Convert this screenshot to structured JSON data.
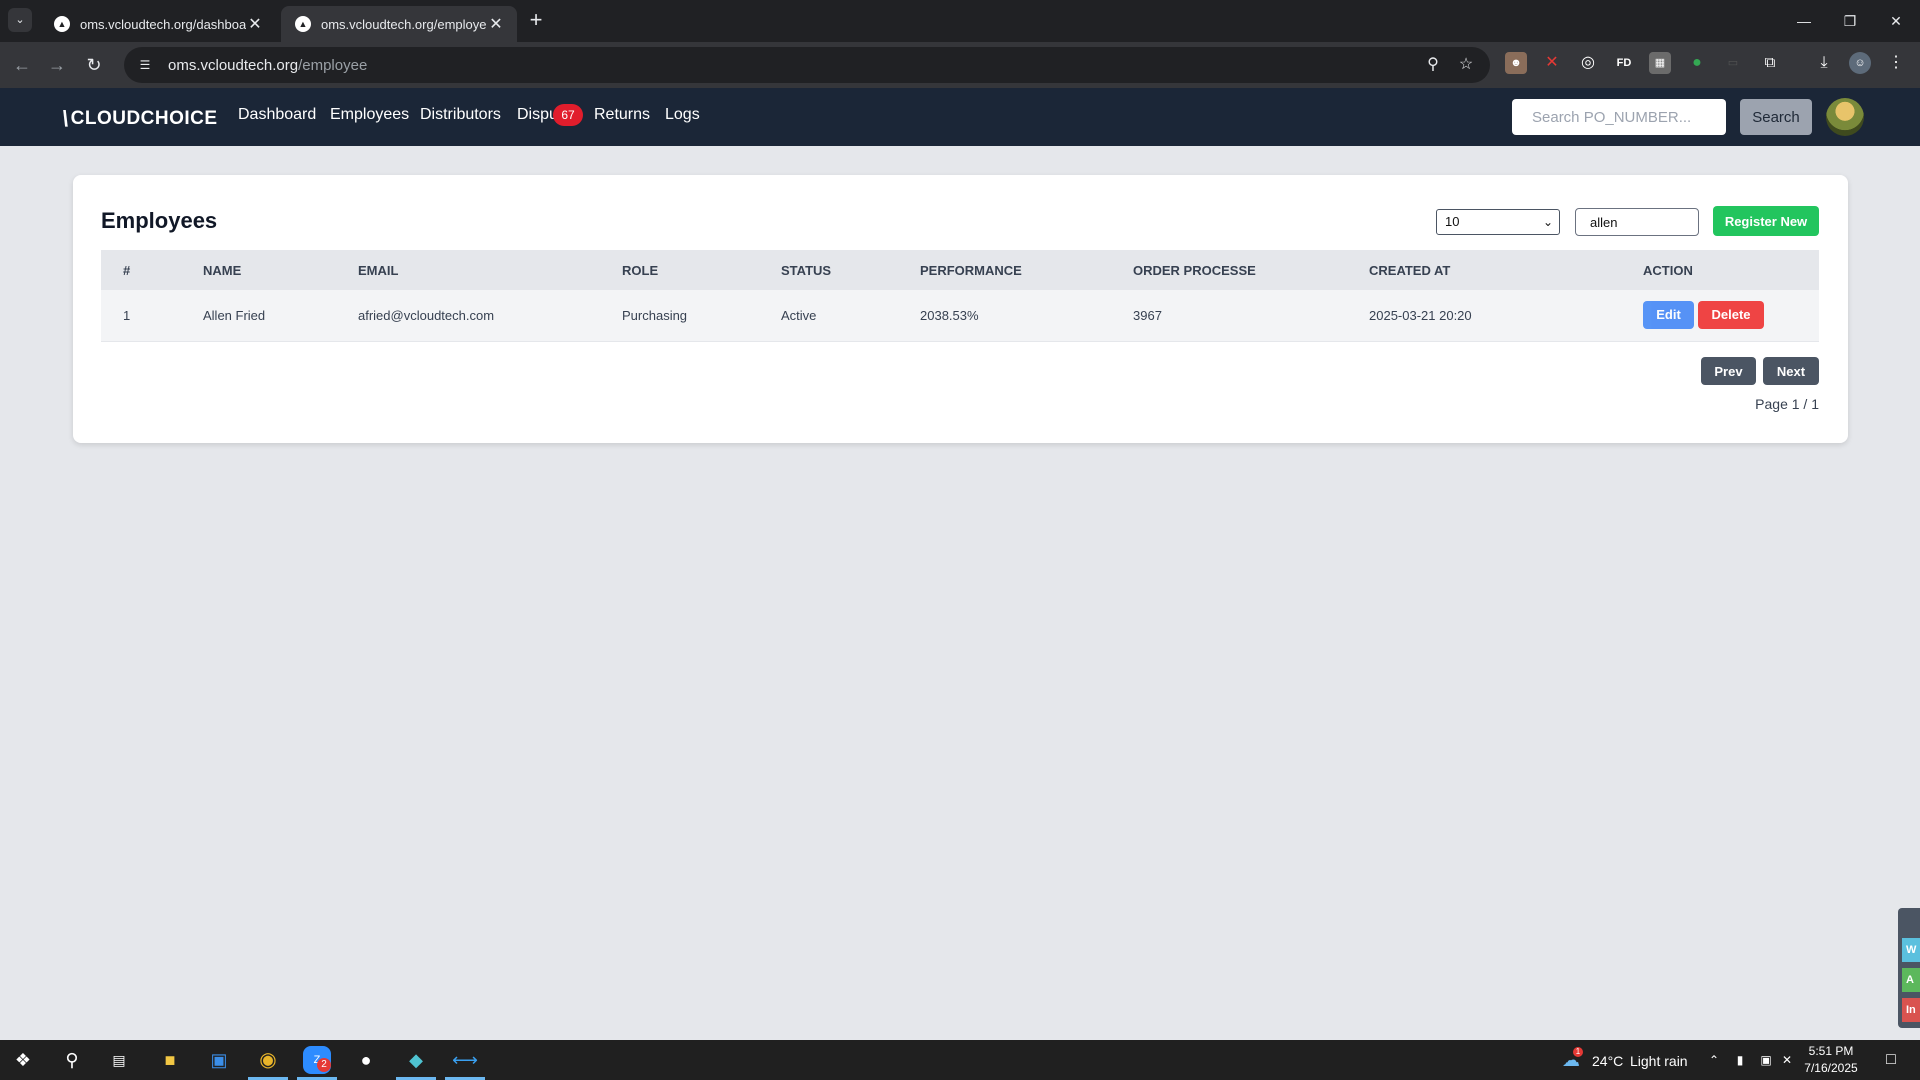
{
  "browser": {
    "tabs": [
      {
        "title": "oms.vcloudtech.org/dashboard",
        "active": false
      },
      {
        "title": "oms.vcloudtech.org/employee",
        "active": true
      }
    ],
    "url_host": "oms.vcloudtech.org",
    "url_path": "/employee",
    "extensions": [
      "puzzle-face-icon",
      "x-icon",
      "globe-icon",
      "fd-icon",
      "image-icon",
      "green-circle-icon",
      "cast-icon",
      "puzzle-icon",
      "download-icon",
      "profile-icon",
      "menu-icon"
    ]
  },
  "nav": {
    "logo_text": "CLOUDCHOICE",
    "links": [
      {
        "label": "Dashboard"
      },
      {
        "label": "Employees"
      },
      {
        "label": "Distributors"
      },
      {
        "label": "Dispu"
      },
      {
        "label": "Returns"
      },
      {
        "label": "Logs"
      }
    ],
    "disputes_badge": "67",
    "search_placeholder": "Search PO_NUMBER...",
    "search_label": "Search"
  },
  "employees": {
    "title": "Employees",
    "page_size": "10",
    "filter_value": "allen",
    "register_label": "Register New",
    "columns": [
      "#",
      "NAME",
      "EMAIL",
      "ROLE",
      "STATUS",
      "PERFORMANCE",
      "ORDER PROCESSE",
      "CREATED AT",
      "ACTION"
    ],
    "rows": [
      {
        "index": "1",
        "name": "Allen Fried",
        "email": "afried@vcloudtech.com",
        "role": "Purchasing",
        "status": "Active",
        "performance": "2038.53%",
        "orders": "3967",
        "created_at": "2025-03-21 20:20",
        "edit_label": "Edit",
        "delete_label": "Delete"
      }
    ],
    "prev_label": "Prev",
    "next_label": "Next",
    "page_info": "Page 1 / 1"
  },
  "side_widget": {
    "items": [
      "W",
      "A",
      "In"
    ]
  },
  "taskbar": {
    "weather_temp": "24°C",
    "weather_text": "Light rain",
    "weather_alert": "1",
    "zoom_badge": "2",
    "time": "5:51 PM",
    "date": "7/16/2025"
  },
  "colors": {
    "navbar": "#1b2637",
    "register": "#22c55e",
    "edit": "#3b82f6",
    "delete": "#ef4444",
    "badge": "#e11d2c"
  }
}
